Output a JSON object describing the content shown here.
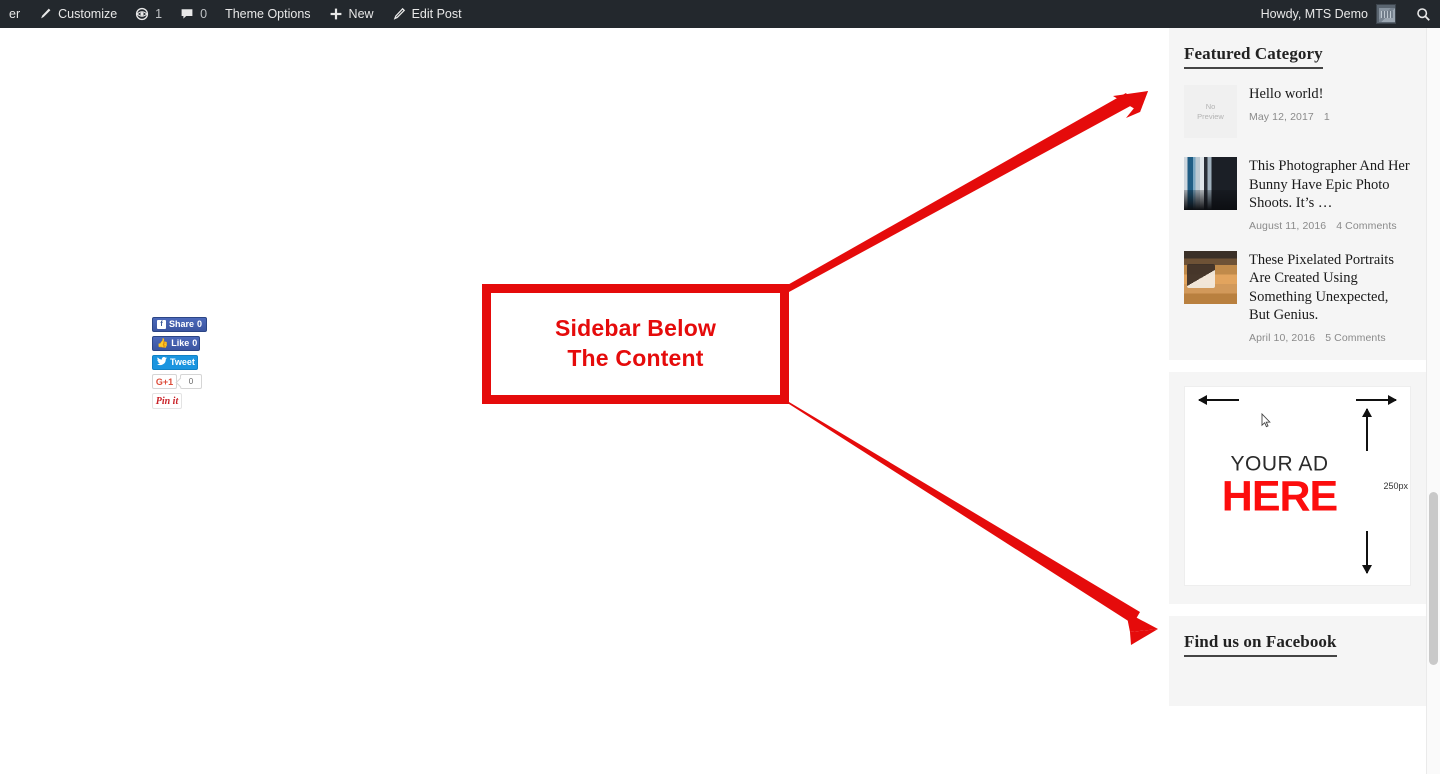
{
  "adminbar": {
    "left_items": [
      {
        "id": "site-name",
        "label": "er",
        "icon": "",
        "count": null
      },
      {
        "id": "customize",
        "label": "Customize",
        "icon": "brush-icon",
        "count": null
      },
      {
        "id": "revisions",
        "label": "",
        "icon": "eye-icon",
        "count": "1"
      },
      {
        "id": "comments",
        "label": "",
        "icon": "comment-bubble-icon",
        "count": "0"
      },
      {
        "id": "theme-options",
        "label": "Theme Options",
        "icon": "",
        "count": null
      },
      {
        "id": "new",
        "label": "New",
        "icon": "plus-icon",
        "count": null
      },
      {
        "id": "edit-post",
        "label": "Edit Post",
        "icon": "pencil-icon",
        "count": null
      }
    ],
    "howdy": "Howdy, MTS Demo",
    "search_icon": "search-icon"
  },
  "share": {
    "facebook_share": {
      "label": "Share",
      "count": "0",
      "icon": "facebook-icon"
    },
    "facebook_like": {
      "label": "Like",
      "count": "0",
      "icon": "thumbs-up-icon"
    },
    "twitter": {
      "label": "Tweet",
      "icon": "twitter-bird-icon"
    },
    "googleplus": {
      "label": "G+1",
      "count": "0"
    },
    "pinterest": {
      "label": "Pin it",
      "icon": "pinterest-icon"
    }
  },
  "sidebar": {
    "featured": {
      "title": "Featured Category",
      "posts": [
        {
          "title": "Hello world!",
          "date": "May 12, 2017",
          "comments": "1",
          "thumb_label": "No\nPreview",
          "thumb_kind": "placeholder"
        },
        {
          "title": "This Photographer And Her Bunny Have Epic Photo Shoots. It’s …",
          "date": "August 11, 2016",
          "comments": "4 Comments",
          "thumb_label": "",
          "thumb_kind": "photo-a"
        },
        {
          "title": "These Pixelated Portraits Are Created Using Something Unexpected, But Genius.",
          "date": "April 10, 2016",
          "comments": "5 Comments",
          "thumb_label": "",
          "thumb_kind": "photo-b"
        }
      ]
    },
    "ad": {
      "line1": "YOUR AD",
      "line2": "HERE",
      "dimension": "250px",
      "accent_color": "#fc0d0d"
    },
    "facebook": {
      "title": "Find us on Facebook"
    }
  },
  "annotation": {
    "callout_text": "Sidebar Below\nThe Content",
    "color": "#e50b0b"
  }
}
